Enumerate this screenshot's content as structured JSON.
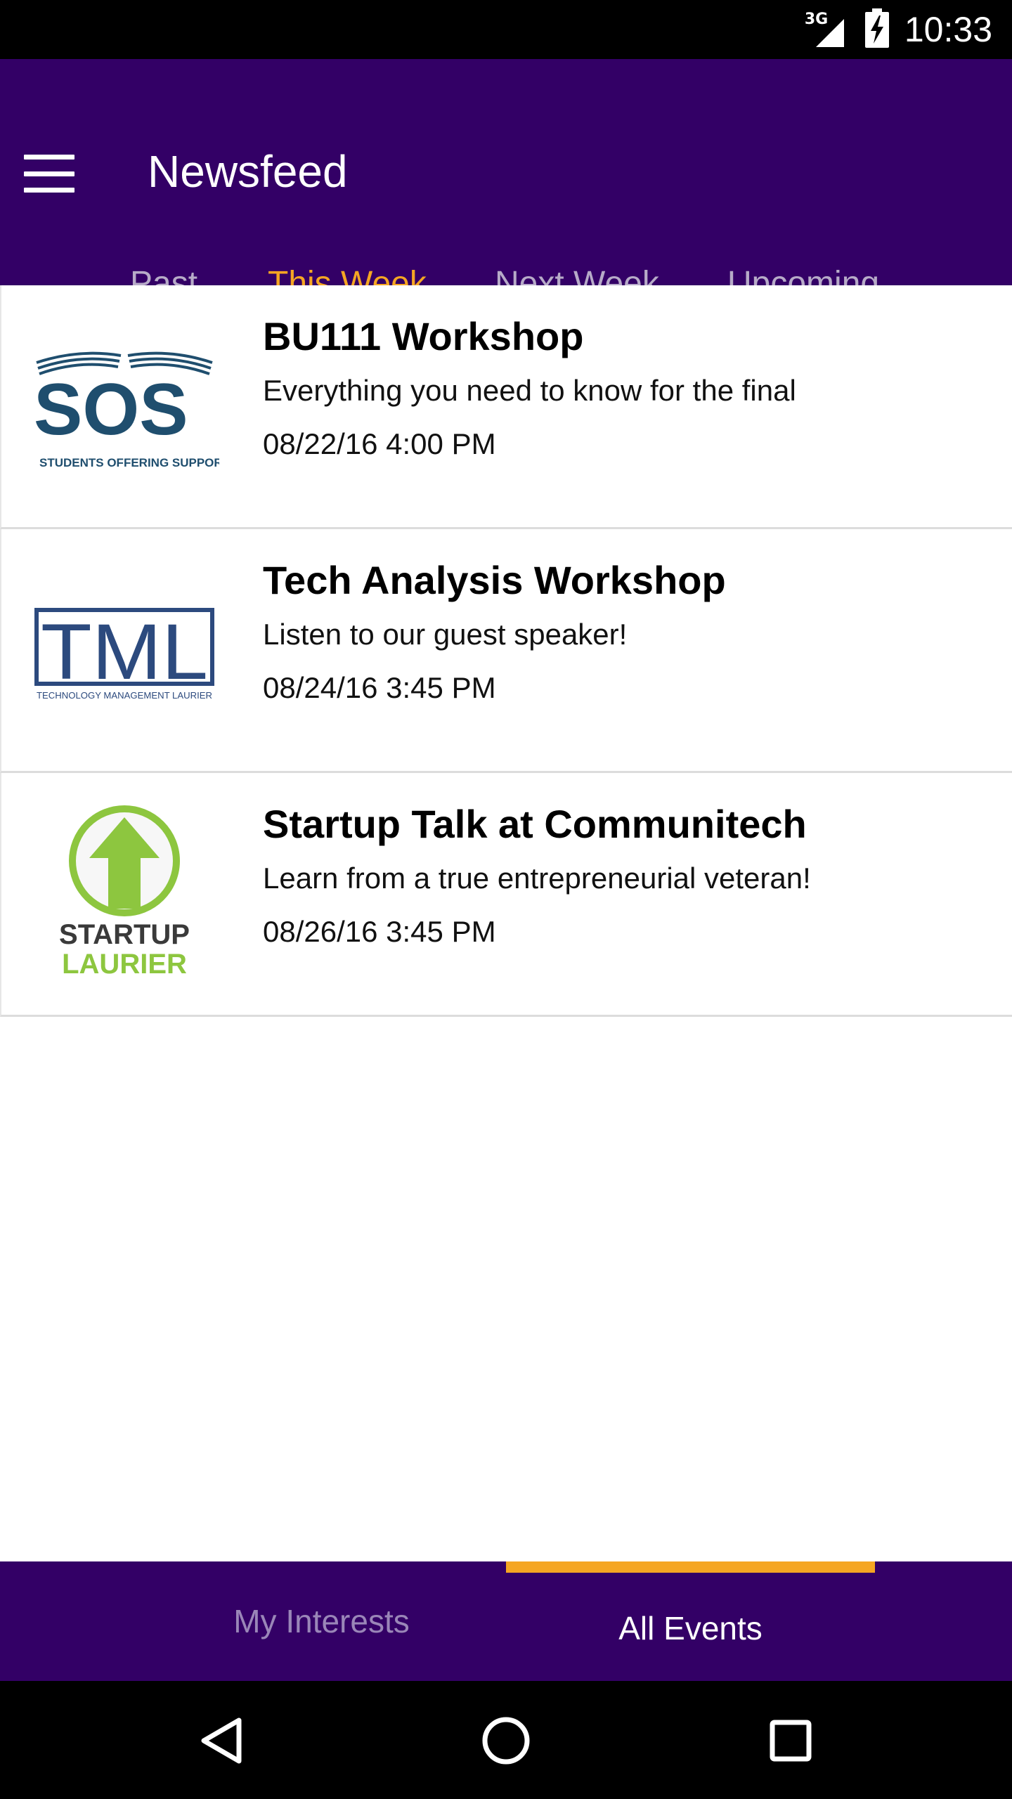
{
  "status_bar": {
    "network": "3G",
    "time": "10:33"
  },
  "app_bar": {
    "title": "Newsfeed",
    "tabs": [
      {
        "label": "Past",
        "active": false
      },
      {
        "label": "This Week",
        "active": true
      },
      {
        "label": "Next Week",
        "active": false
      },
      {
        "label": "Upcoming",
        "active": false
      }
    ]
  },
  "events": [
    {
      "logo": {
        "name": "sos-logo",
        "main_text": "SOS",
        "sub_text": "STUDENTS OFFERING SUPPORT"
      },
      "title": "BU111 Workshop",
      "description": "Everything you need to know for the final",
      "datetime": "08/22/16 4:00 PM"
    },
    {
      "logo": {
        "name": "tml-logo",
        "main_text": "TML",
        "sub_text": "TECHNOLOGY MANAGEMENT LAURIER"
      },
      "title": "Tech Analysis Workshop",
      "description": "Listen to our guest speaker!",
      "datetime": "08/24/16 3:45 PM"
    },
    {
      "logo": {
        "name": "startup-laurier-logo",
        "main_text": "STARTUP",
        "sub_text": "LAURIER"
      },
      "title": "Startup Talk at Communitech",
      "description": "Learn from a true entrepreneurial veteran!",
      "datetime": "08/26/16 3:45 PM"
    }
  ],
  "bottom_tabs": [
    {
      "label": "My Interests",
      "active": false
    },
    {
      "label": "All Events",
      "active": true
    }
  ],
  "colors": {
    "primary": "#330066",
    "accent": "#f5a623",
    "sos_blue": "#1f4e6e",
    "tml_blue": "#2c4a7e",
    "startup_green": "#8dc63f"
  },
  "icons": [
    "menu-icon",
    "signal-icon",
    "battery-icon",
    "back-icon",
    "home-icon",
    "recents-icon"
  ]
}
